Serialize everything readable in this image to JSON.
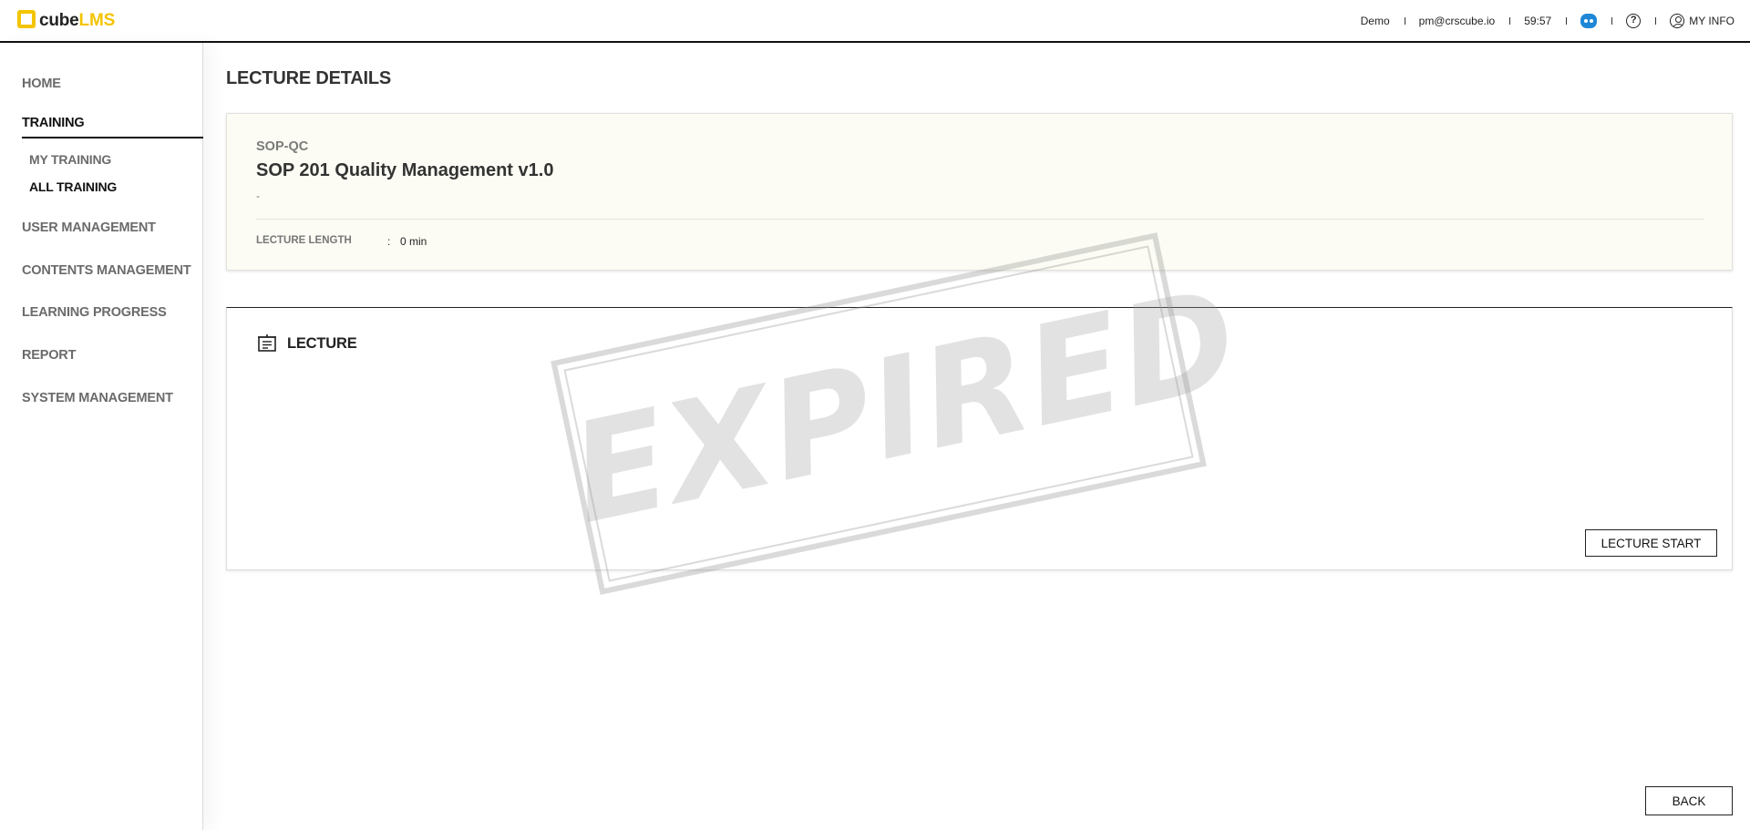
{
  "header": {
    "logo_cube": "cube",
    "logo_lms": "LMS",
    "brand_color": "#f3c400",
    "env": "Demo",
    "email": "pm@crscube.io",
    "timer": "59:57",
    "bot_icon": "chatbot-icon",
    "help_icon": "help-circle-icon",
    "help_glyph": "?",
    "my_info": "MY INFO"
  },
  "sidebar": {
    "items": [
      {
        "label": "HOME"
      },
      {
        "label": "TRAINING"
      },
      {
        "label": "USER MANAGEMENT"
      },
      {
        "label": "CONTENTS MANAGEMENT"
      },
      {
        "label": "LEARNING PROGRESS"
      },
      {
        "label": "REPORT"
      },
      {
        "label": "SYSTEM MANAGEMENT"
      }
    ],
    "training_sub": [
      {
        "label": "MY TRAINING"
      },
      {
        "label": "ALL TRAINING"
      }
    ],
    "active": "TRAINING",
    "active_sub": "ALL TRAINING"
  },
  "main": {
    "page_title": "LECTURE DETAILS",
    "course": {
      "code": "SOP-QC",
      "name": "SOP 201 Quality Management v1.0",
      "description": "-",
      "length_label": "LECTURE LENGTH",
      "length_colon": ":",
      "length_value": "0 min"
    },
    "lecture": {
      "title": "LECTURE",
      "start_button": "LECTURE START"
    },
    "back_button": "BACK",
    "stamp_text": "EXPIRED"
  }
}
